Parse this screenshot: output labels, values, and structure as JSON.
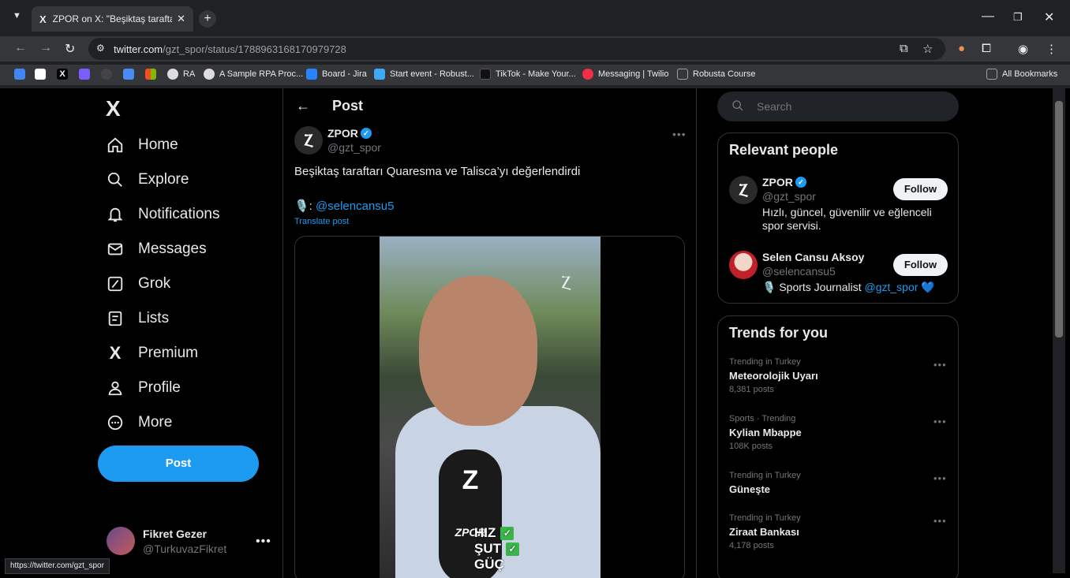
{
  "browser": {
    "tab_title": "ZPOR on X: \"Beşiktaş taraftarı Q",
    "url_host": "twitter.com",
    "url_path": "/gzt_spor/status/1788963168170979728",
    "status_url": "https://twitter.com/gzt_spor",
    "bookmarks": [
      {
        "label": "",
        "color": "#4285f4"
      },
      {
        "label": "",
        "color": "#ffffff"
      },
      {
        "label": "",
        "color": "#000000"
      },
      {
        "label": "",
        "color": "#7c5cff"
      },
      {
        "label": "",
        "color": "#555555"
      },
      {
        "label": "",
        "color": "#4a8af4"
      },
      {
        "label": "",
        "color": "#f4b400"
      },
      {
        "label": "RA",
        "color": "#dddddd"
      },
      {
        "label": "A Sample RPA Proc...",
        "color": "#dddddd"
      },
      {
        "label": "Board - Jira",
        "color": "#2684ff"
      },
      {
        "label": "Start event - Robust...",
        "color": "#3fa9f5"
      },
      {
        "label": "TikTok - Make Your...",
        "color": "#111111"
      },
      {
        "label": "Messaging | Twilio",
        "color": "#f22f46"
      },
      {
        "label": "Robusta Course",
        "color": "#9aa0a6"
      }
    ],
    "all_bookmarks": "All Bookmarks"
  },
  "nav": {
    "items": [
      {
        "label": "Home",
        "icon": "home-icon"
      },
      {
        "label": "Explore",
        "icon": "search-icon"
      },
      {
        "label": "Notifications",
        "icon": "bell-icon"
      },
      {
        "label": "Messages",
        "icon": "mail-icon"
      },
      {
        "label": "Grok",
        "icon": "grok-icon"
      },
      {
        "label": "Lists",
        "icon": "list-icon"
      },
      {
        "label": "Premium",
        "icon": "x-icon"
      },
      {
        "label": "Profile",
        "icon": "person-icon"
      },
      {
        "label": "More",
        "icon": "more-circle-icon"
      }
    ],
    "post_button": "Post",
    "user": {
      "name": "Fikret Gezer",
      "handle": "@TurkuvazFikret"
    }
  },
  "post": {
    "header_title": "Post",
    "author_name": "ZPOR",
    "author_handle": "@gzt_spor",
    "text": "Beşiktaş taraftarı Quaresma ve Talisca’yı değerlendirdi",
    "mic_prefix": "🎙️:",
    "mention": "@selencansu5",
    "translate": "Translate post",
    "video_overlay": [
      "HIZ",
      "ŞUT",
      "GÜÇ"
    ],
    "mic_logo": "Z",
    "mic_brand": "ZPOR"
  },
  "search": {
    "placeholder": "Search"
  },
  "relevant_people": {
    "title": "Relevant people",
    "people": [
      {
        "name": "ZPOR",
        "handle": "@gzt_spor",
        "bio": "Hızlı, güncel, güvenilir ve eğlenceli spor servisi.",
        "follow": "Follow"
      },
      {
        "name": "Selen Cansu Aksoy",
        "handle": "@selencansu5",
        "bio_prefix": "🎙️ Sports Journalist ",
        "bio_mention": "@gzt_spor",
        "bio_suffix": " 💙",
        "follow": "Follow"
      }
    ]
  },
  "trends": {
    "title": "Trends for you",
    "items": [
      {
        "meta": "Trending in Turkey",
        "name": "Meteorolojik Uyarı",
        "count": "8,381 posts"
      },
      {
        "meta": "Sports · Trending",
        "name": "Kylian Mbappe",
        "count": "108K posts"
      },
      {
        "meta": "Trending in Turkey",
        "name": "Güneşte",
        "count": ""
      },
      {
        "meta": "Trending in Turkey",
        "name": "Ziraat Bankası",
        "count": "4,178 posts"
      }
    ]
  }
}
